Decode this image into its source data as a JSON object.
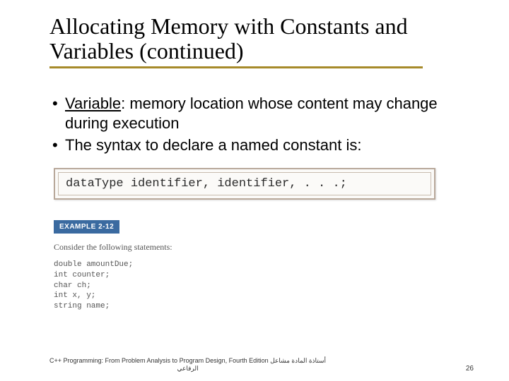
{
  "title": "Allocating Memory with Constants and Variables (continued)",
  "bullets": [
    {
      "term": "Variable",
      "rest": ": memory location whose content may change during execution"
    },
    {
      "term": "",
      "rest": "The syntax to declare a named constant is:"
    }
  ],
  "syntax": "dataType identifier, identifier, . . .;",
  "example_label": "EXAMPLE 2-12",
  "example_intro": "Consider the following statements:",
  "code_lines": [
    "double amountDue;",
    "int counter;",
    "char ch;",
    "int x, y;",
    "string name;"
  ],
  "footer_left_line1": "C++ Programming: From Problem Analysis to Program Design, Fourth Edition أستاذة المادة مشاعل",
  "footer_left_line2": "الرفاعي",
  "page_number": "26"
}
